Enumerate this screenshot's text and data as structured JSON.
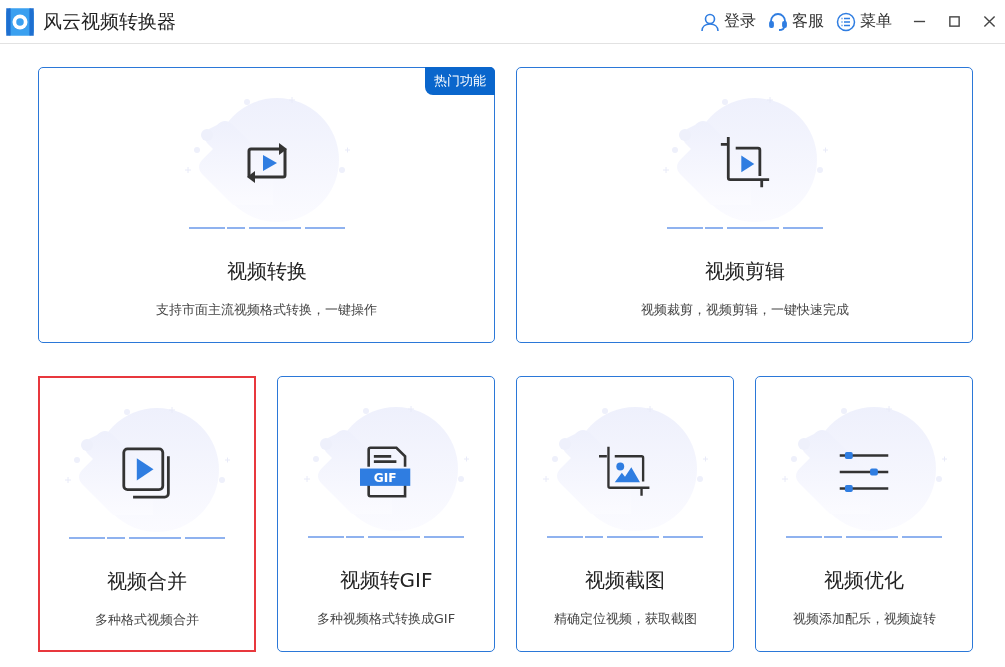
{
  "window": {
    "title": "风云视频转换器"
  },
  "header_actions": [
    {
      "kind": "user",
      "label": "登录"
    },
    {
      "kind": "headset",
      "label": "客服"
    },
    {
      "kind": "menu",
      "label": "菜单"
    }
  ],
  "cards": [
    {
      "kind": "convert",
      "title": "视频转换",
      "description": "支持市面主流视频格式转换，一键操作",
      "badge": "热门功能",
      "selected": false
    },
    {
      "kind": "crop-play",
      "title": "视频剪辑",
      "description": "视频裁剪，视频剪辑，一键快速完成",
      "selected": false
    },
    {
      "kind": "merge",
      "title": "视频合并",
      "description": "多种格式视频合并",
      "selected": true
    },
    {
      "kind": "gif",
      "title": "视频转GIF",
      "description": "多种视频格式转换成GIF",
      "icon_label": "GIF",
      "selected": false
    },
    {
      "kind": "crop-image",
      "title": "视频截图",
      "description": "精确定位视频，获取截图",
      "selected": false
    },
    {
      "kind": "sliders",
      "title": "视频优化",
      "description": "视频添加配乐，视频旋转",
      "selected": false
    }
  ]
}
